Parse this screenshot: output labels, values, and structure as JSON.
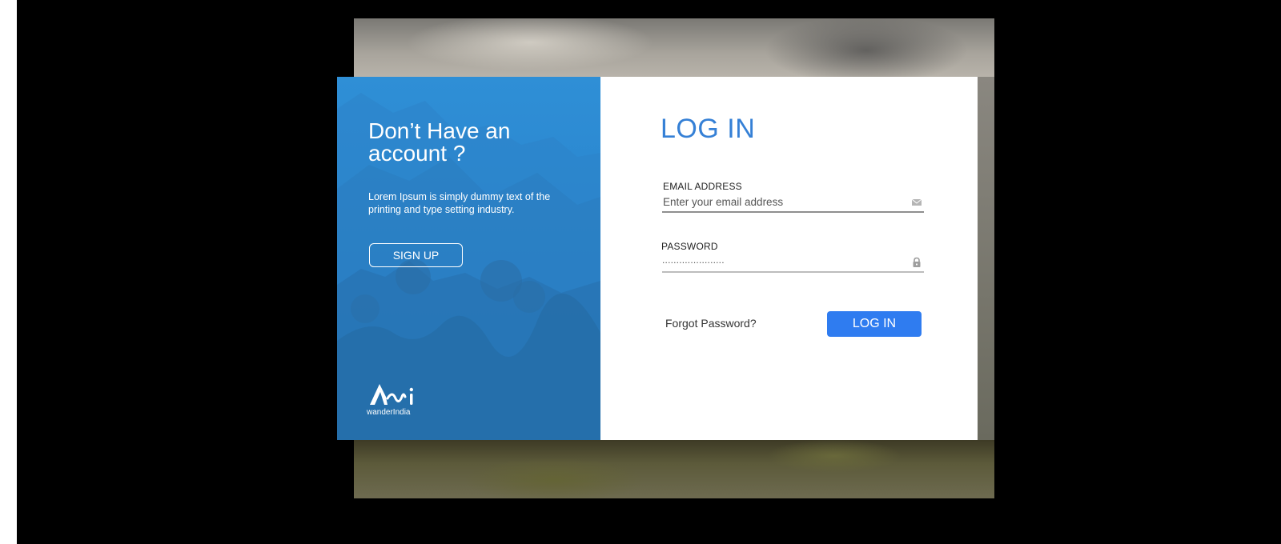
{
  "signup_panel": {
    "title": "Don’t Have an account ?",
    "description": "Lorem Ipsum is simply dummy text of the printing and type setting industry.",
    "signup_label": "SIGN UP",
    "brand_name": "wanderIndia"
  },
  "login_panel": {
    "title": "LOG IN",
    "email": {
      "label": "EMAIL ADDRESS",
      "placeholder": "Enter your email address",
      "icon": "envelope-icon"
    },
    "password": {
      "label": "PASSWORD",
      "masked_value": "......................",
      "icon": "lock-icon"
    },
    "forgot_label": "Forgot Password?",
    "login_label": "LOG IN"
  },
  "colors": {
    "accent": "#2f7cf0",
    "title": "#3580d6",
    "panel_blue": "#2a86cf",
    "backdrop": "#000000"
  }
}
